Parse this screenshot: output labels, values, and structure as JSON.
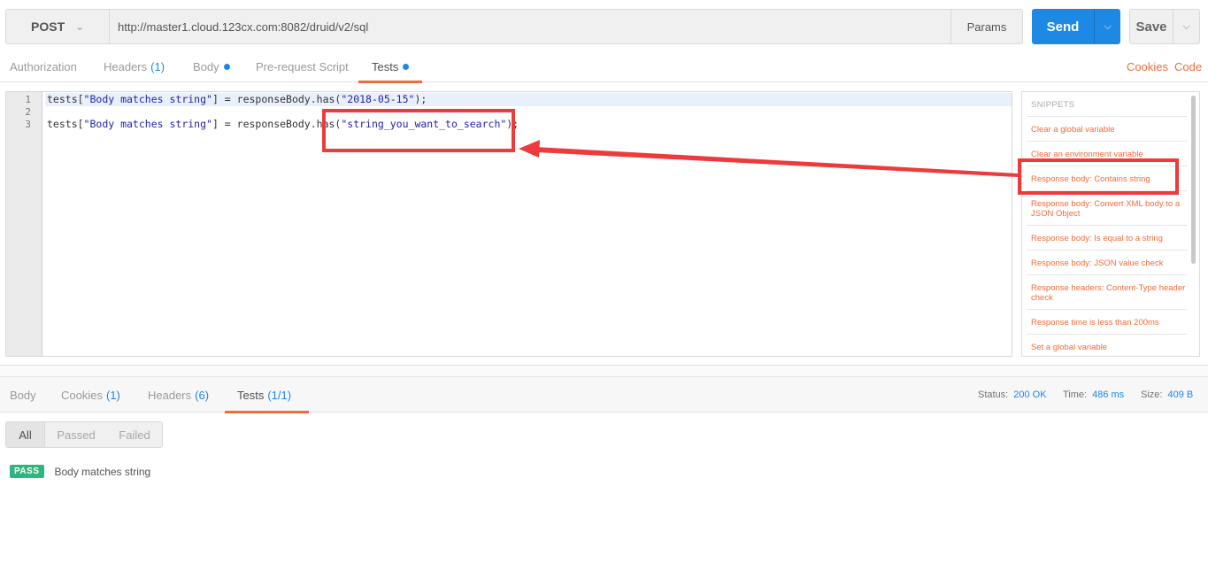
{
  "request": {
    "method": "POST",
    "url": "http://master1.cloud.123cx.com:8082/druid/v2/sql",
    "params_label": "Params",
    "send_label": "Send",
    "save_label": "Save"
  },
  "request_tabs": [
    {
      "label": "Authorization"
    },
    {
      "label": "Headers",
      "count": "(1)"
    },
    {
      "label": "Body",
      "dot": true
    },
    {
      "label": "Pre-request Script"
    },
    {
      "label": "Tests",
      "dot": true,
      "active": true
    }
  ],
  "request_links": {
    "cookies": "Cookies",
    "code": "Code"
  },
  "editor": {
    "line_numbers": [
      "1",
      "2",
      "3"
    ],
    "lines": [
      {
        "prefix": "tests[",
        "s1": "\"Body matches string\"",
        "mid": "] = responseBody.has(",
        "s2": "\"2018-05-15\"",
        "suffix": ");"
      },
      {
        "prefix": "",
        "s1": "",
        "mid": "",
        "s2": "",
        "suffix": ""
      },
      {
        "prefix": "tests[",
        "s1": "\"Body matches string\"",
        "mid": "] = responseBody.has(",
        "s2": "\"string_you_want_to_search\"",
        "suffix": ");"
      }
    ]
  },
  "snippets": {
    "heading": "SNIPPETS",
    "items": [
      "Clear a global variable",
      "Clear an environment variable",
      "Response body: Contains string",
      "Response body: Convert XML body to a JSON Object",
      "Response body: Is equal to a string",
      "Response body: JSON value check",
      "Response headers: Content-Type header check",
      "Response time is less than 200ms",
      "Set a global variable"
    ]
  },
  "response_tabs": [
    {
      "label": "Body"
    },
    {
      "label": "Cookies",
      "count": "(1)"
    },
    {
      "label": "Headers",
      "count": "(6)"
    },
    {
      "label": "Tests",
      "count": "(1/1)",
      "active": true
    }
  ],
  "response_status": {
    "status_label": "Status:",
    "status_value": "200 OK",
    "time_label": "Time:",
    "time_value": "486 ms",
    "size_label": "Size:",
    "size_value": "409 B"
  },
  "test_filter": [
    "All",
    "Passed",
    "Failed"
  ],
  "test_results": [
    {
      "badge": "PASS",
      "name": "Body matches string"
    }
  ],
  "colors": {
    "accent_orange": "#f26b3a",
    "primary_blue": "#1e88e5",
    "pass_green": "#2fb67c",
    "annotation_red": "#ee3a3a"
  },
  "icons": {
    "method_dropdown": "chevron-down-icon",
    "send_dropdown": "chevron-down-icon",
    "save_dropdown": "chevron-down-icon"
  }
}
